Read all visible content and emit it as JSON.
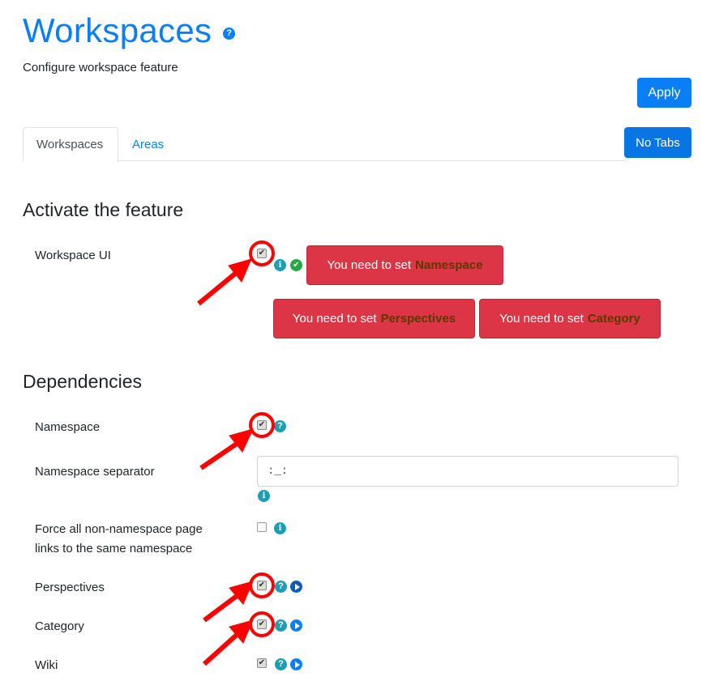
{
  "header": {
    "title": "Workspaces",
    "help_icon": "question-circle-icon",
    "subtitle": "Configure workspace feature",
    "apply_label": "Apply"
  },
  "tabs": {
    "items": [
      {
        "label": "Workspaces",
        "active": true
      },
      {
        "label": "Areas",
        "active": false
      }
    ],
    "no_tabs_label": "No Tabs"
  },
  "activate": {
    "heading": "Activate the feature",
    "workspace_ui": {
      "label": "Workspace UI",
      "checked": true,
      "icons": [
        "info-icon",
        "check-circle-icon"
      ]
    },
    "warnings": [
      {
        "prefix": "You need to set",
        "target": "Namespace"
      },
      {
        "prefix": "You need to set",
        "target": "Perspectives"
      },
      {
        "prefix": "You need to set",
        "target": "Category"
      }
    ]
  },
  "dependencies": {
    "heading": "Dependencies",
    "namespace": {
      "label": "Namespace",
      "checked": true,
      "icons": [
        "help-icon"
      ]
    },
    "namespace_separator": {
      "label": "Namespace separator",
      "value": ":_:",
      "icons": [
        "info-icon"
      ]
    },
    "force_links": {
      "label_line1": "Force all non-namespace page",
      "label_line2": "links to the same namespace",
      "checked": false,
      "icons": [
        "info-icon"
      ]
    },
    "perspectives": {
      "label": "Perspectives",
      "checked": true,
      "icons": [
        "help-icon",
        "play-icon"
      ]
    },
    "category": {
      "label": "Category",
      "checked": true,
      "icons": [
        "help-icon",
        "play-icon"
      ]
    },
    "wiki": {
      "label": "Wiki",
      "checked": true,
      "icons": [
        "help-icon",
        "play-icon"
      ]
    }
  },
  "glyphs": {
    "check": "✔",
    "question": "?",
    "info": "i",
    "ok": "✔"
  },
  "colors": {
    "primary": "#0a7ff5",
    "danger": "#dc3545",
    "info": "#1b9eb6",
    "success": "#28a745",
    "annotation": "#ff0000"
  }
}
